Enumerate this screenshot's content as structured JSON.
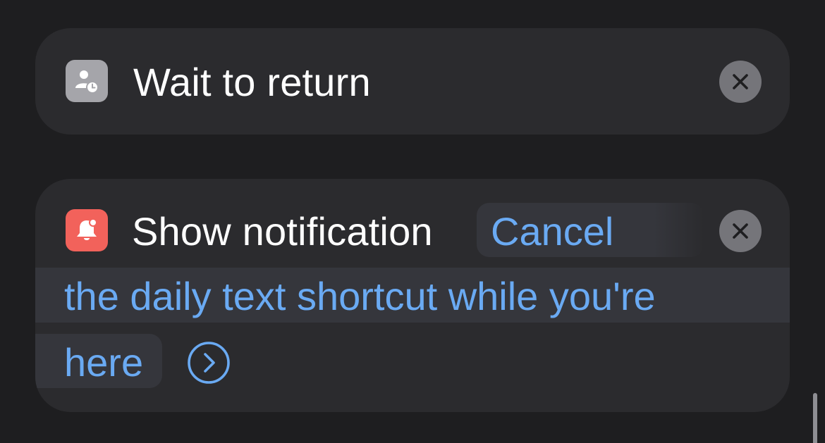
{
  "actions": {
    "wait_to_return": {
      "icon": "person-clock-icon",
      "title": "Wait to return",
      "remove_icon": "close-icon"
    },
    "show_notification": {
      "icon": "bell-badge-icon",
      "title": "Show notification",
      "message_part1": "Cancel",
      "message_part2": "the daily text shortcut while you're",
      "message_part3": "here",
      "expand_icon": "chevron-right-circle-icon",
      "remove_icon": "close-icon"
    }
  },
  "colors": {
    "background": "#1e1e20",
    "card": "#2b2b2e",
    "token_background": "#35363c",
    "token_text": "#6aaaf3",
    "icon_gray": "#a5a5aa",
    "icon_red": "#f2625b",
    "close_button": "#75757a"
  }
}
